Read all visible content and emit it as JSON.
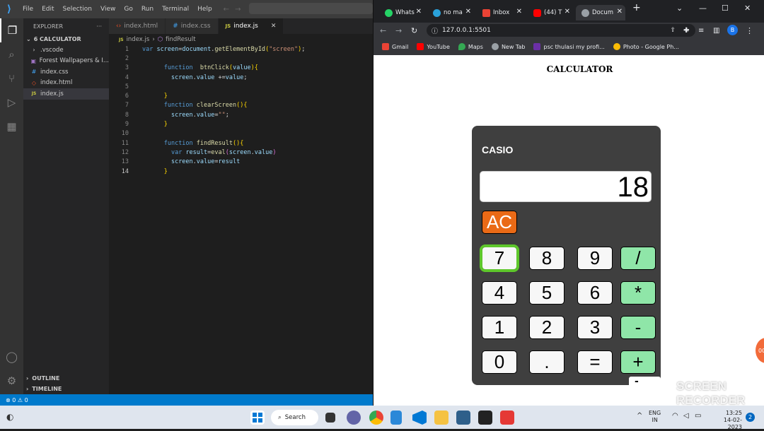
{
  "vscode": {
    "menu": [
      "File",
      "Edit",
      "Selection",
      "View",
      "Go",
      "Run",
      "Terminal",
      "Help"
    ],
    "explorer_title": "EXPLORER",
    "folder": "6 CALCULATOR",
    "files": [
      {
        "name": ".vscode",
        "icon": "chevron-right-icon",
        "color": "#cccccc"
      },
      {
        "name": "Forest Wallpapers & I...",
        "icon": "image-icon",
        "color": "#a074c4"
      },
      {
        "name": "index.css",
        "icon": "css-icon",
        "color": "#42a5f5"
      },
      {
        "name": "index.html",
        "icon": "html-icon",
        "color": "#e44d26"
      },
      {
        "name": "index.js",
        "icon": "js-icon",
        "color": "#cbcb41"
      }
    ],
    "outline": "OUTLINE",
    "timeline": "TIMELINE",
    "tabs": [
      {
        "label": "index.html",
        "icon": "<>"
      },
      {
        "label": "index.css",
        "icon": "#"
      },
      {
        "label": "index.js",
        "icon": "JS"
      }
    ],
    "breadcrumb": [
      "index.js",
      "findResult"
    ],
    "status": "⊗ 0 ⚠ 0"
  },
  "browser": {
    "tabs": [
      "Whats",
      "no ma",
      "Inbox",
      "(44) T",
      "Docum"
    ],
    "url": "127.0.0.1:5501",
    "bookmarks": [
      "Gmail",
      "YouTube",
      "Maps",
      "New Tab",
      "psc thulasi my profi...",
      "Photo - Google Ph..."
    ],
    "profile": "B"
  },
  "page": {
    "title": "CALCULATOR",
    "brand": "CASIO",
    "display": "18",
    "ac": "AC",
    "keys": [
      [
        "7",
        "8",
        "9",
        "/"
      ],
      [
        "4",
        "5",
        "6",
        "*"
      ],
      [
        "1",
        "2",
        "3",
        "-"
      ],
      [
        "0",
        ".",
        "=",
        "+"
      ]
    ]
  },
  "overlay": {
    "rec": "-",
    "watermark1": "SCREEN",
    "watermark2": "RECORDER",
    "side": "00"
  },
  "taskbar": {
    "search": "Search",
    "lang1": "ENG",
    "lang2": "IN",
    "time": "13:25",
    "date": "14-02-2023",
    "badge": "2"
  }
}
